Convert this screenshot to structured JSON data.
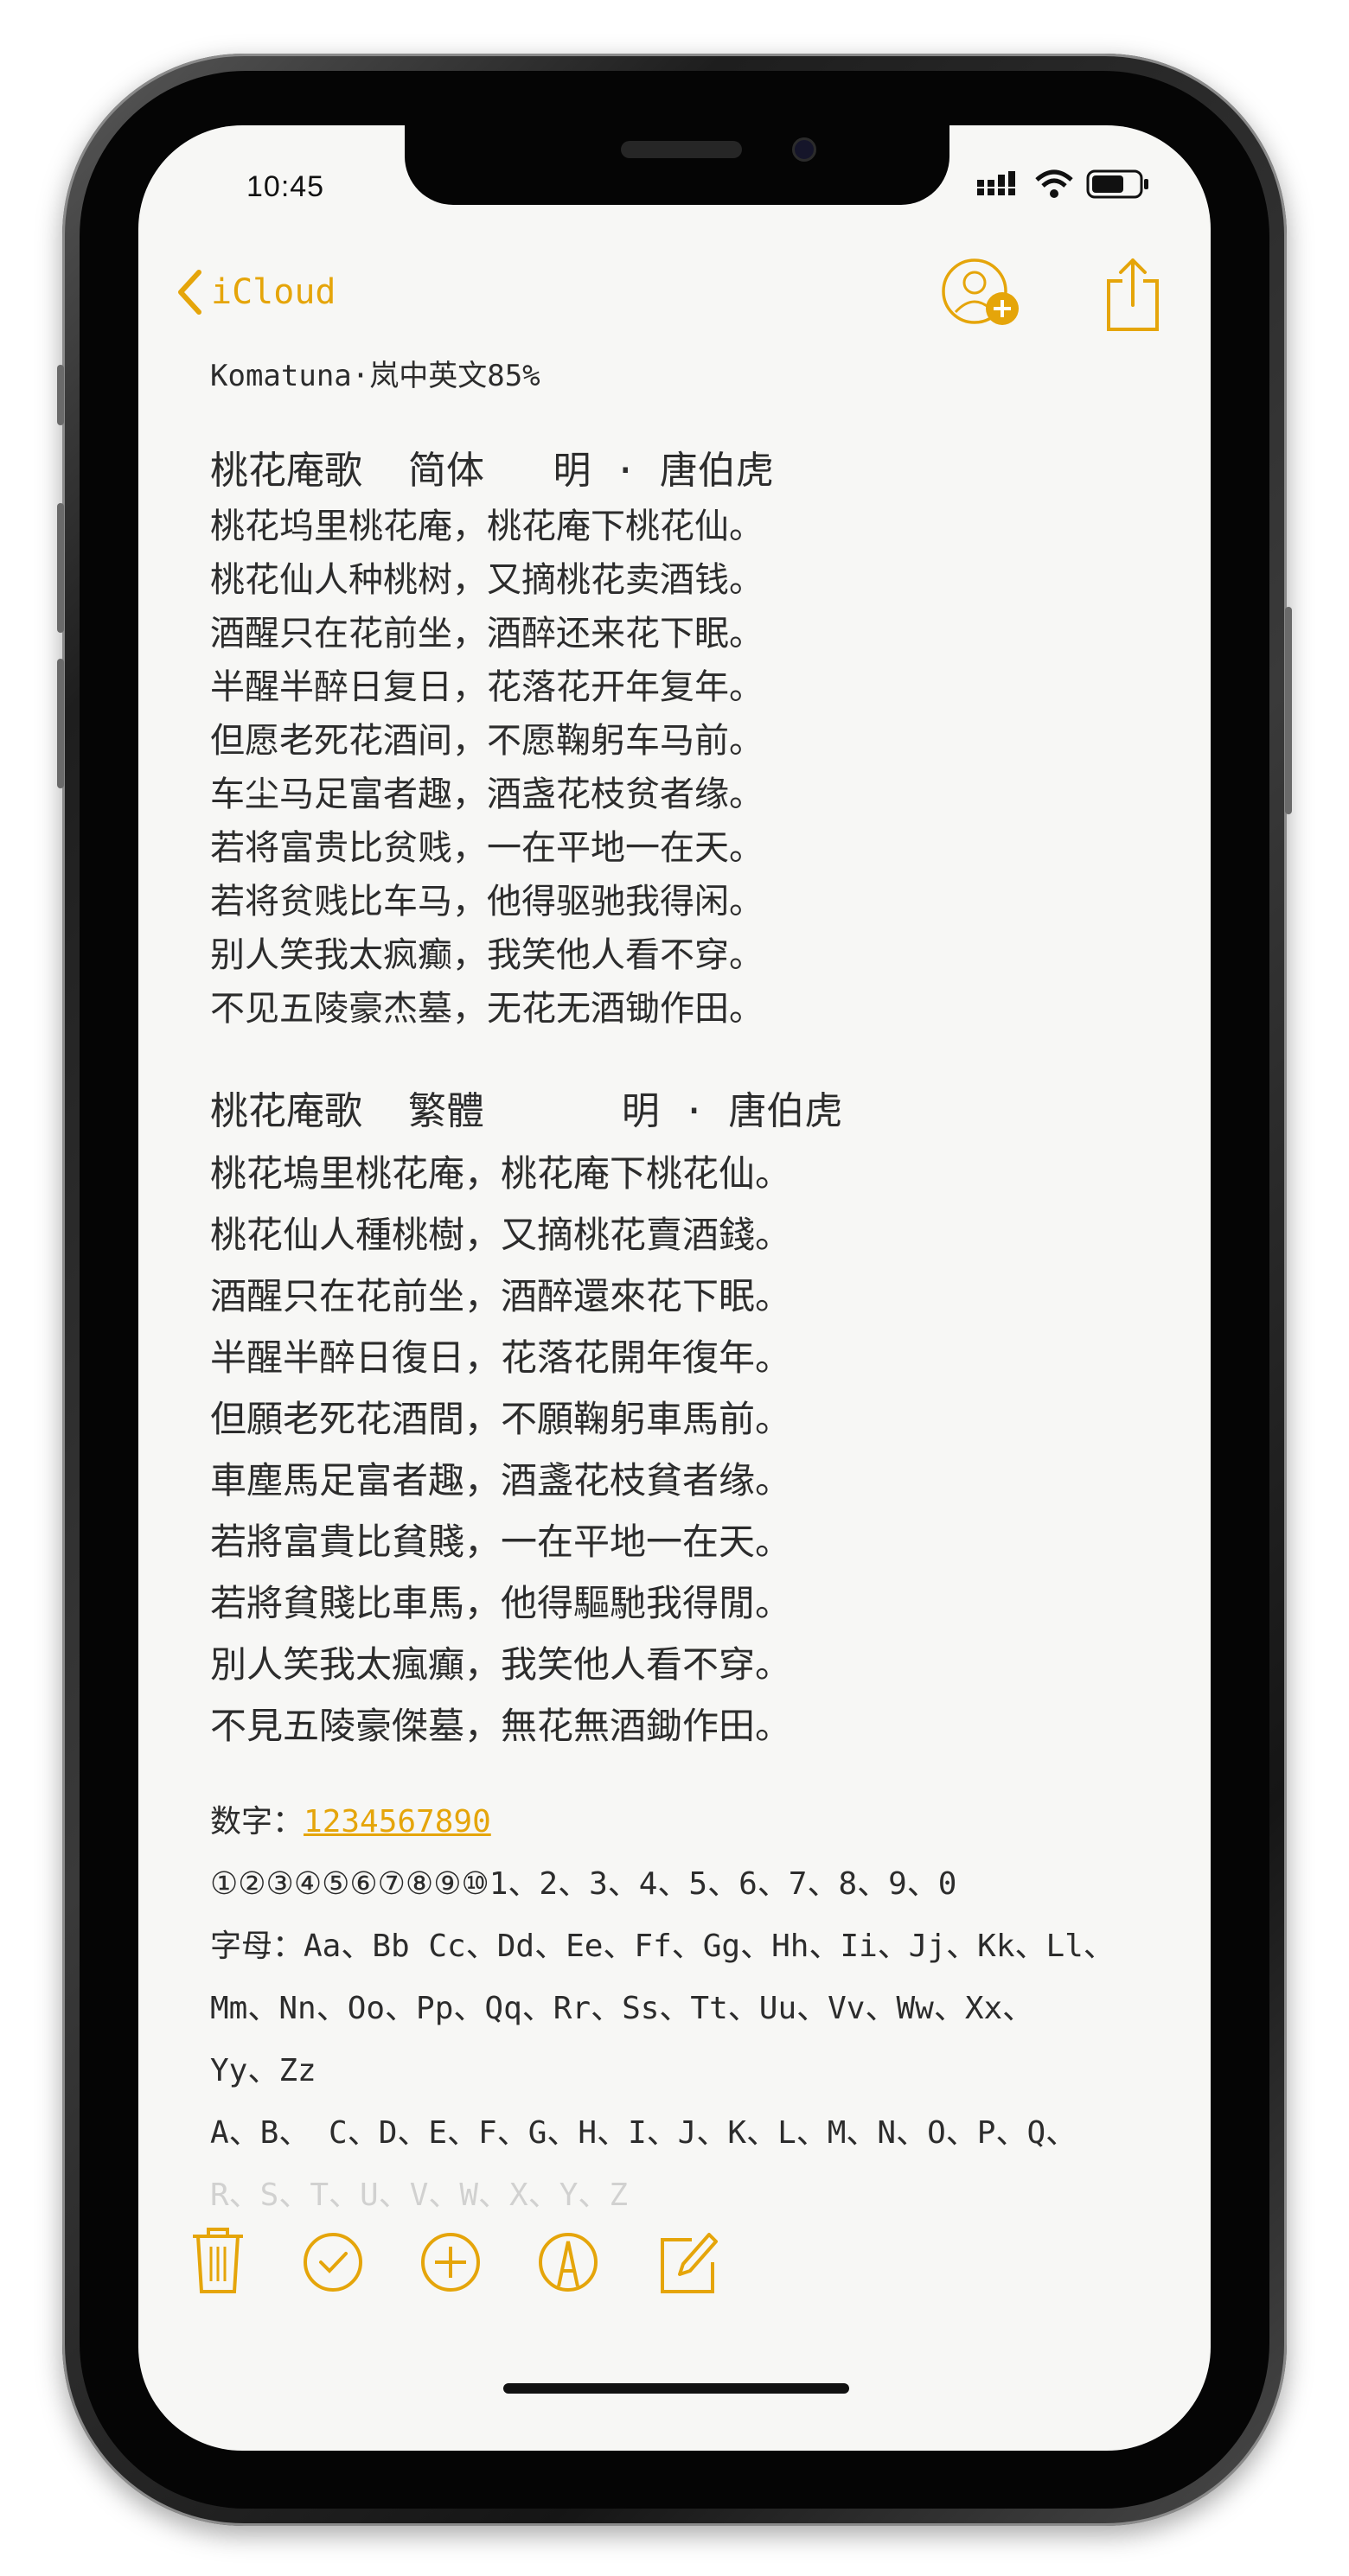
{
  "status": {
    "time": "10:45"
  },
  "nav": {
    "back_label": "iCloud"
  },
  "font_line": "Komatuna·岚中英文85%",
  "poem_simplified": {
    "title": "桃花庵歌  简体   明 · 唐伯虎",
    "lines": [
      "桃花坞里桃花庵，桃花庵下桃花仙。",
      "桃花仙人种桃树，又摘桃花卖酒钱。",
      "酒醒只在花前坐，酒醉还来花下眠。",
      "半醒半醉日复日，花落花开年复年。",
      "但愿老死花酒间，不愿鞠躬车马前。",
      "车尘马足富者趣，酒盏花枝贫者缘。",
      "若将富贵比贫贱，一在平地一在天。",
      "若将贫贱比车马，他得驱驰我得闲。",
      "别人笑我太疯癫，我笑他人看不穿。",
      "不见五陵豪杰墓，无花无酒锄作田。"
    ]
  },
  "poem_traditional": {
    "title": "桃花庵歌  繁體      明 · 唐伯虎",
    "lines": [
      "桃花塢里桃花庵，桃花庵下桃花仙。",
      "桃花仙人種桃樹，又摘桃花賣酒錢。",
      "酒醒只在花前坐，酒醉還來花下眠。",
      "半醒半醉日復日，花落花開年復年。",
      "但願老死花酒間，不願鞠躬車馬前。",
      "車塵馬足富者趣，酒盞花枝貧者缘。",
      "若將富貴比貧賤，一在平地一在天。",
      "若將貧賤比車馬，他得驅馳我得閒。",
      "別人笑我太瘋癲，我笑他人看不穿。",
      "不見五陵豪傑墓，無花無酒鋤作田。"
    ]
  },
  "extras": {
    "digits_label": "数字：",
    "digits_link": "1234567890",
    "circled": "①②③④⑤⑥⑦⑧⑨⑩1、2、3、4、5、6、7、8、9、0",
    "letters_1": "字母：Aa、Bb Cc、Dd、Ee、Ff、Gg、Hh、Ii、Jj、Kk、Ll、",
    "letters_2": "Mm、Nn、Oo、Pp、Qq、Rr、Ss、Tt、Uu、Vv、Ww、Xx、",
    "letters_3": "Yy、Zz",
    "upper_1": "A、B、 C、D、E、F、G、H、I、J、K、L、M、N、O、P、Q、",
    "upper_2": "R、S、T、U、V、W、X、Y、Z"
  },
  "colors": {
    "accent": "#e5a50a",
    "text": "#2c2c2c",
    "paper": "#f7f7f5"
  },
  "icons": {
    "nav": [
      "chevron-left-icon",
      "add-person-icon",
      "share-icon"
    ],
    "toolbar": [
      "trash-icon",
      "checklist-icon",
      "add-icon",
      "markup-icon",
      "compose-icon"
    ]
  }
}
